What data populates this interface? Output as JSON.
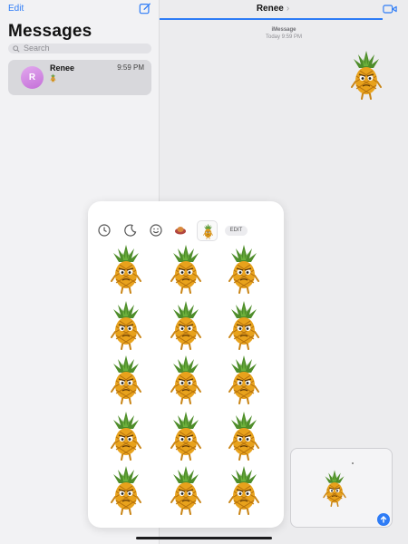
{
  "sidebar": {
    "edit_label": "Edit",
    "title": "Messages",
    "search_placeholder": "Search",
    "conversations": [
      {
        "initial": "R",
        "name": "Renee",
        "time": "9:59 PM"
      }
    ]
  },
  "conversation": {
    "contact_name": "Renee",
    "chevron": "›",
    "service_label": "iMessage",
    "timestamp": "Today 9:59 PM"
  },
  "drawer": {
    "tabs": [
      "recents-icon",
      "moon-icon",
      "emoji-icon",
      "sticker-pack-icon",
      "pineapple-pack-icon"
    ],
    "edit_label": "EDIT",
    "sticker_count": 15
  },
  "colors": {
    "accent": "#2e7cf6",
    "pineapple_body": "#e8a21c",
    "pineapple_leaves": "#4e8d2a"
  }
}
